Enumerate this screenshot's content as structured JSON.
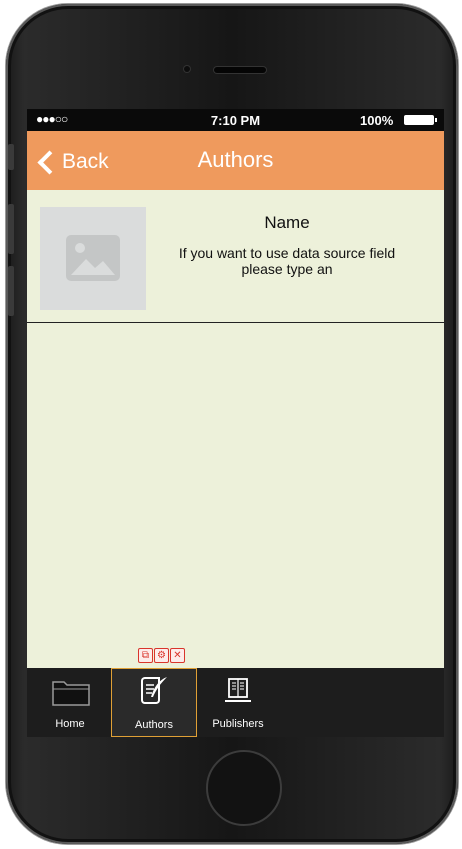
{
  "status": {
    "signal": "●●●○○",
    "time": "7:10 PM",
    "battery": "100%"
  },
  "nav": {
    "back_label": "Back",
    "title": "Authors"
  },
  "list": {
    "items": [
      {
        "name": "Name",
        "description": "If you want to use data source field please type an"
      }
    ]
  },
  "tabs": [
    {
      "label": "Home",
      "icon": "folder-icon"
    },
    {
      "label": "Authors",
      "icon": "quill-scroll-icon",
      "active": true
    },
    {
      "label": "Publishers",
      "icon": "book-icon"
    }
  ],
  "edit_controls": {
    "copy": "⧉",
    "settings": "⚙",
    "delete": "✕"
  },
  "colors": {
    "navbar": "#ef9a5d",
    "content_bg": "#edf1da",
    "tab_active_border": "#e0a035"
  }
}
